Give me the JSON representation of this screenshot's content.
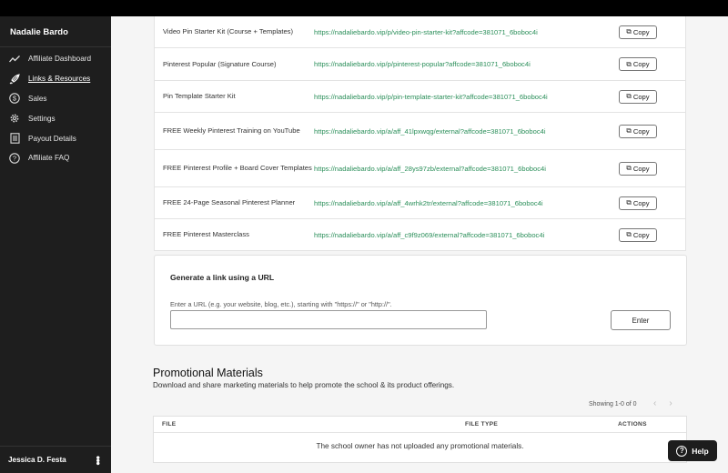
{
  "sidebar": {
    "brand": "Nadalie Bardo",
    "items": [
      {
        "label": "Affiliate Dashboard",
        "icon": "trend-line-icon"
      },
      {
        "label": "Links & Resources",
        "icon": "rocket-icon",
        "active": true
      },
      {
        "label": "Sales",
        "icon": "dollar-circle-icon"
      },
      {
        "label": "Settings",
        "icon": "gear-icon"
      },
      {
        "label": "Payout Details",
        "icon": "document-icon"
      },
      {
        "label": "Affiliate FAQ",
        "icon": "question-circle-icon"
      }
    ],
    "user": "Jessica D. Festa"
  },
  "links": {
    "copy_label": "Copy",
    "rows": [
      {
        "name": "Video Pin Starter Kit (Course + Templates)",
        "url": "https://nadaliebardo.vip/p/video-pin-starter-kit?affcode=381071_6boboc4i"
      },
      {
        "name": "Pinterest Popular (Signature Course)",
        "url": "https://nadaliebardo.vip/p/pinterest-popular?affcode=381071_6boboc4i"
      },
      {
        "name": "Pin Template Starter Kit",
        "url": "https://nadaliebardo.vip/p/pin-template-starter-kit?affcode=381071_6boboc4i"
      },
      {
        "name": "FREE Weekly Pinterest Training on YouTube",
        "url": "https://nadaliebardo.vip/a/aff_41lpxwqg/external?affcode=381071_6boboc4i"
      },
      {
        "name": "FREE Pinterest Profile + Board Cover Templates",
        "url": "https://nadaliebardo.vip/a/aff_28ys97zb/external?affcode=381071_6boboc4i"
      },
      {
        "name": "FREE 24-Page Seasonal Pinterest Planner",
        "url": "https://nadaliebardo.vip/a/aff_4wrhk2tr/external?affcode=381071_6boboc4i"
      },
      {
        "name": "FREE Pinterest Masterclass",
        "url": "https://nadaliebardo.vip/a/aff_c9f9z069/external?affcode=381071_6boboc4i"
      }
    ]
  },
  "generator": {
    "title": "Generate a link using a URL",
    "hint": "Enter a URL (e.g. your website, blog, etc.), starting with \"https://\" or \"http://\".",
    "input_value": "",
    "button": "Enter"
  },
  "promo": {
    "title": "Promotional Materials",
    "description": "Download and share marketing materials to help promote the school & its product offerings.",
    "showing": "Showing 1-0 of 0",
    "pager_prev": "‹",
    "pager_next": "›",
    "columns": {
      "file": "FILE",
      "type": "FILE TYPE",
      "actions": "ACTIONS"
    },
    "empty": "The school owner has not uploaded any promotional materials."
  },
  "help": {
    "label": "Help"
  }
}
